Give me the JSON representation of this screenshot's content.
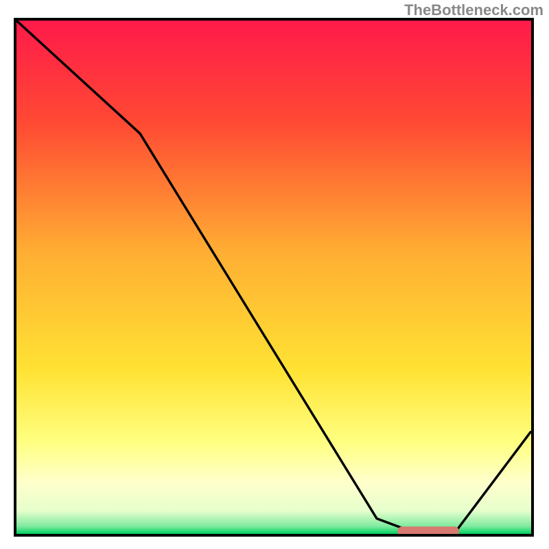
{
  "watermark": "TheBottleneck.com",
  "chart_data": {
    "type": "line",
    "title": "",
    "xlabel": "",
    "ylabel": "",
    "xlim": [
      0,
      100
    ],
    "ylim": [
      0,
      100
    ],
    "gradient_stops": [
      {
        "offset": 0.0,
        "color": "#ff1a4a"
      },
      {
        "offset": 0.2,
        "color": "#ff4a33"
      },
      {
        "offset": 0.45,
        "color": "#ffae33"
      },
      {
        "offset": 0.68,
        "color": "#ffe233"
      },
      {
        "offset": 0.82,
        "color": "#ffff80"
      },
      {
        "offset": 0.9,
        "color": "#ffffcc"
      },
      {
        "offset": 0.955,
        "color": "#e6ffcc"
      },
      {
        "offset": 0.985,
        "color": "#80eaa0"
      },
      {
        "offset": 1.0,
        "color": "#00d060"
      }
    ],
    "series": [
      {
        "name": "bottleneck-curve",
        "x": [
          0,
          24,
          70,
          78,
          85,
          100
        ],
        "y": [
          100,
          78,
          3,
          0,
          0,
          20
        ]
      }
    ],
    "marker": {
      "name": "optimal-range",
      "shape": "rounded-bar",
      "x_start": 74,
      "x_end": 86,
      "y": 0.5,
      "color": "#d77a70"
    }
  }
}
